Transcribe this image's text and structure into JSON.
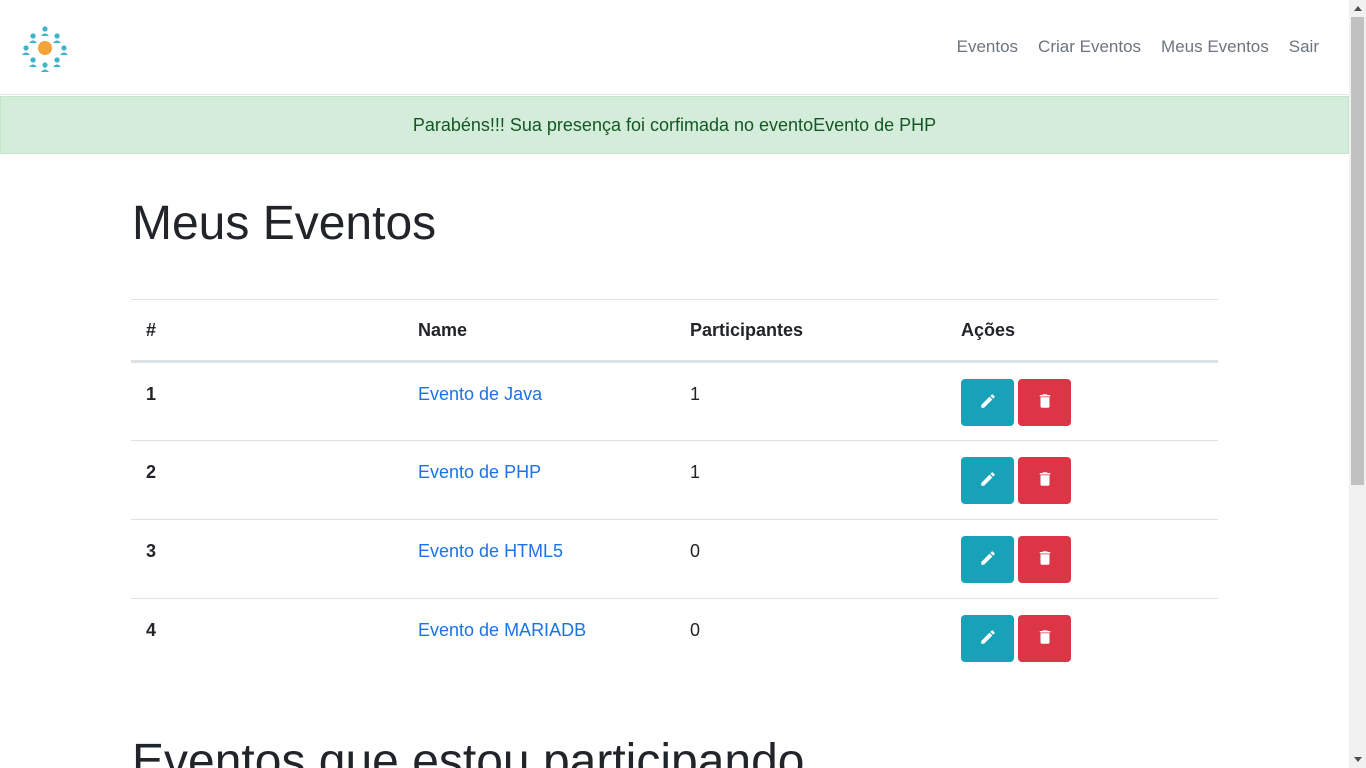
{
  "nav": {
    "links": [
      "Eventos",
      "Criar Eventos",
      "Meus Eventos",
      "Sair"
    ]
  },
  "alert": {
    "message": "Parabéns!!! Sua presença foi corfimada no eventoEvento de PHP"
  },
  "main": {
    "title": "Meus Eventos",
    "table": {
      "headers": [
        "#",
        "Name",
        "Participantes",
        "Ações"
      ],
      "rows": [
        {
          "id": "1",
          "name": "Evento de Java",
          "participants": "1"
        },
        {
          "id": "2",
          "name": "Evento de PHP",
          "participants": "1"
        },
        {
          "id": "3",
          "name": "Evento de HTML5",
          "participants": "0"
        },
        {
          "id": "4",
          "name": "Evento de MARIADB",
          "participants": "0"
        }
      ]
    },
    "section_title": "Eventos que estou participando"
  },
  "icons": {
    "logo": "people-network-icon",
    "edit": "pencil-icon",
    "delete": "trash-icon"
  },
  "colors": {
    "edit_button": "#17a2b8",
    "delete_button": "#dc3545",
    "alert_bg": "#d4edda",
    "alert_text": "#155724",
    "link": "#1a73e8"
  }
}
